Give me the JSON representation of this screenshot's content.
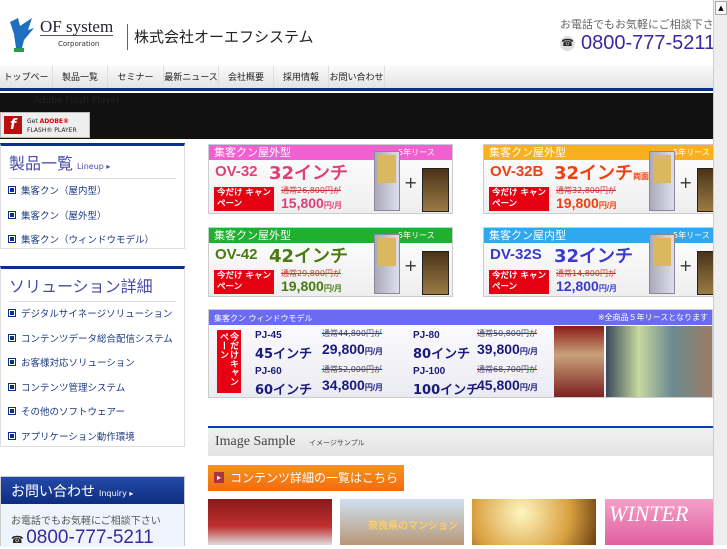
{
  "header": {
    "brand": "OF system",
    "corporation": "Corporation",
    "company_name": "株式会社オーエフシステム",
    "call_text": "お電話でもお気軽にご相談下さい",
    "phone": "0800-777-5211"
  },
  "nav": [
    "トップページ",
    "製品一覧",
    "セミナー",
    "最新ニュース",
    "会社概要",
    "採用情報",
    "お問い合わせ"
  ],
  "flash": {
    "label": "Adobe Flash Player",
    "get": "Get",
    "adobe": "ADOBE®",
    "player": "FLASH® PLAYER"
  },
  "sidebar": {
    "lineup": {
      "title": "製品一覧",
      "sub": "Lineup ▸",
      "items": [
        "集客クン（屋内型）",
        "集客クン（屋外型）",
        "集客クン（ウィンドウモデル）"
      ]
    },
    "solutions": {
      "title": "ソリューション詳細",
      "items": [
        "デジタルサイネージソリューション",
        "コンテンツデータ総合配信システム",
        "お客様対応ソリューション",
        "コンテンツ管理システム",
        "その他のソフトウェアー",
        "アプリケーション動作環境"
      ]
    },
    "inquiry": {
      "title": "お問い合わせ",
      "sub": "Inquiry ▸",
      "text": "お電話でもお気軽にご相談下さい",
      "phone": "0800-777-5211"
    }
  },
  "banners": [
    {
      "header": "集客クン屋外型",
      "lease": "5年リース",
      "model": "OV-32",
      "inch": "32インチ",
      "extra": "",
      "campaign": "今だけ キャンペーン",
      "old": "通常26,800円が",
      "price": "15,800",
      "unit": "円/月",
      "color": "#f060d0",
      "text_color": "#e0407a"
    },
    {
      "header": "集客クン屋外型",
      "lease": "5年リース",
      "model": "OV-32B",
      "inch": "32インチ",
      "extra": "両面",
      "campaign": "今だけ キャンペーン",
      "old": "通常32,800円が",
      "price": "19,800",
      "unit": "円/月",
      "color": "#f8b020",
      "text_color": "#f04010"
    },
    {
      "header": "集客クン屋外型",
      "lease": "5年リース",
      "model": "OV-42",
      "inch": "42インチ",
      "extra": "",
      "campaign": "今だけ キャンペーン",
      "old": "通常29,800円が",
      "price": "19,800",
      "unit": "円/月",
      "color": "#20b030",
      "text_color": "#4a7a10"
    },
    {
      "header": "集客クン屋内型",
      "lease": "5年リース",
      "model": "DV-32S",
      "inch": "32インチ",
      "extra": "",
      "campaign": "今だけ キャンペーン",
      "old": "通常14,800円が",
      "price": "12,800",
      "unit": "円/月",
      "color": "#30a8f0",
      "text_color": "#3a3ad0"
    }
  ],
  "window_banner": {
    "header": "集客クン ウィンドウモデル",
    "note": "※全商品５年リースとなります",
    "campaign": "今だけキャンペーン",
    "items": [
      {
        "model": "PJ-45",
        "inch": "45インチ",
        "old": "通常44,800円が",
        "price": "29,800",
        "unit": "円/月"
      },
      {
        "model": "PJ-80",
        "inch": "80インチ",
        "old": "通常50,800円が",
        "price": "39,800",
        "unit": "円/月"
      },
      {
        "model": "PJ-60",
        "inch": "60インチ",
        "old": "通常52,000円が",
        "price": "34,800",
        "unit": "円/月"
      },
      {
        "model": "PJ-100",
        "inch": "100インチ",
        "old": "通常68,700円が",
        "price": "45,800",
        "unit": "円/月"
      }
    ]
  },
  "image_sample": {
    "title": "Image Sample",
    "subtitle": "イメージサンプル",
    "more_button": "コンテンツ詳細の一覧はこちら",
    "thumbs": [
      "",
      "奈良県のマンション",
      "",
      "WINTER"
    ]
  }
}
